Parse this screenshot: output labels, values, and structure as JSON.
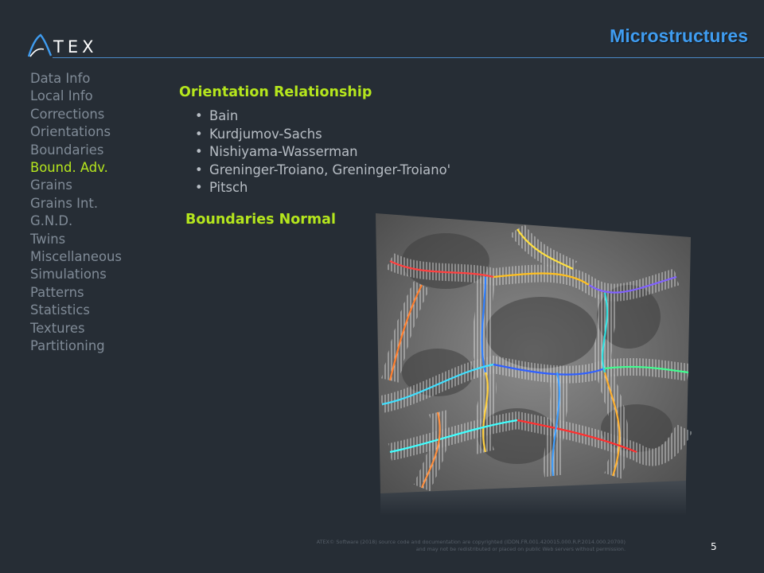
{
  "logo": {
    "text": "TEX"
  },
  "header": {
    "title": "Microstructures"
  },
  "sidebar": {
    "items": [
      {
        "label": "Data Info"
      },
      {
        "label": "Local Info"
      },
      {
        "label": "Corrections"
      },
      {
        "label": "Orientations"
      },
      {
        "label": "Boundaries"
      },
      {
        "label": "Bound. Adv."
      },
      {
        "label": "Grains"
      },
      {
        "label": "Grains Int."
      },
      {
        "label": "G.N.D."
      },
      {
        "label": "Twins"
      },
      {
        "label": "Miscellaneous"
      },
      {
        "label": "Simulations"
      },
      {
        "label": "Patterns"
      },
      {
        "label": "Statistics"
      },
      {
        "label": "Textures"
      },
      {
        "label": "Partitioning"
      }
    ],
    "active_index": 5
  },
  "content": {
    "orientation_title": "Orientation Relationship",
    "orientation_items": [
      "Bain",
      "Kurdjumov-Sachs",
      "Nishiyama-Wasserman",
      "Greninger-Troiano, Greninger-Troiano'",
      "Pitsch"
    ],
    "boundaries_title": "Boundaries Normal"
  },
  "footer": {
    "line1": "ATEX© Software (2018) source code and documentation are copyrighted (IDDN.FR.001.420015.000.R.P.2014.000.20700)",
    "line2": "and may not be redistributed or placed on public Web servers without permission."
  },
  "page_number": "5",
  "colors": {
    "background": "#262d35",
    "accent_title": "#3f9cf0",
    "active_item": "#b5e61d",
    "sidebar_item": "#808b97",
    "header_rule": "#4a88c4"
  }
}
